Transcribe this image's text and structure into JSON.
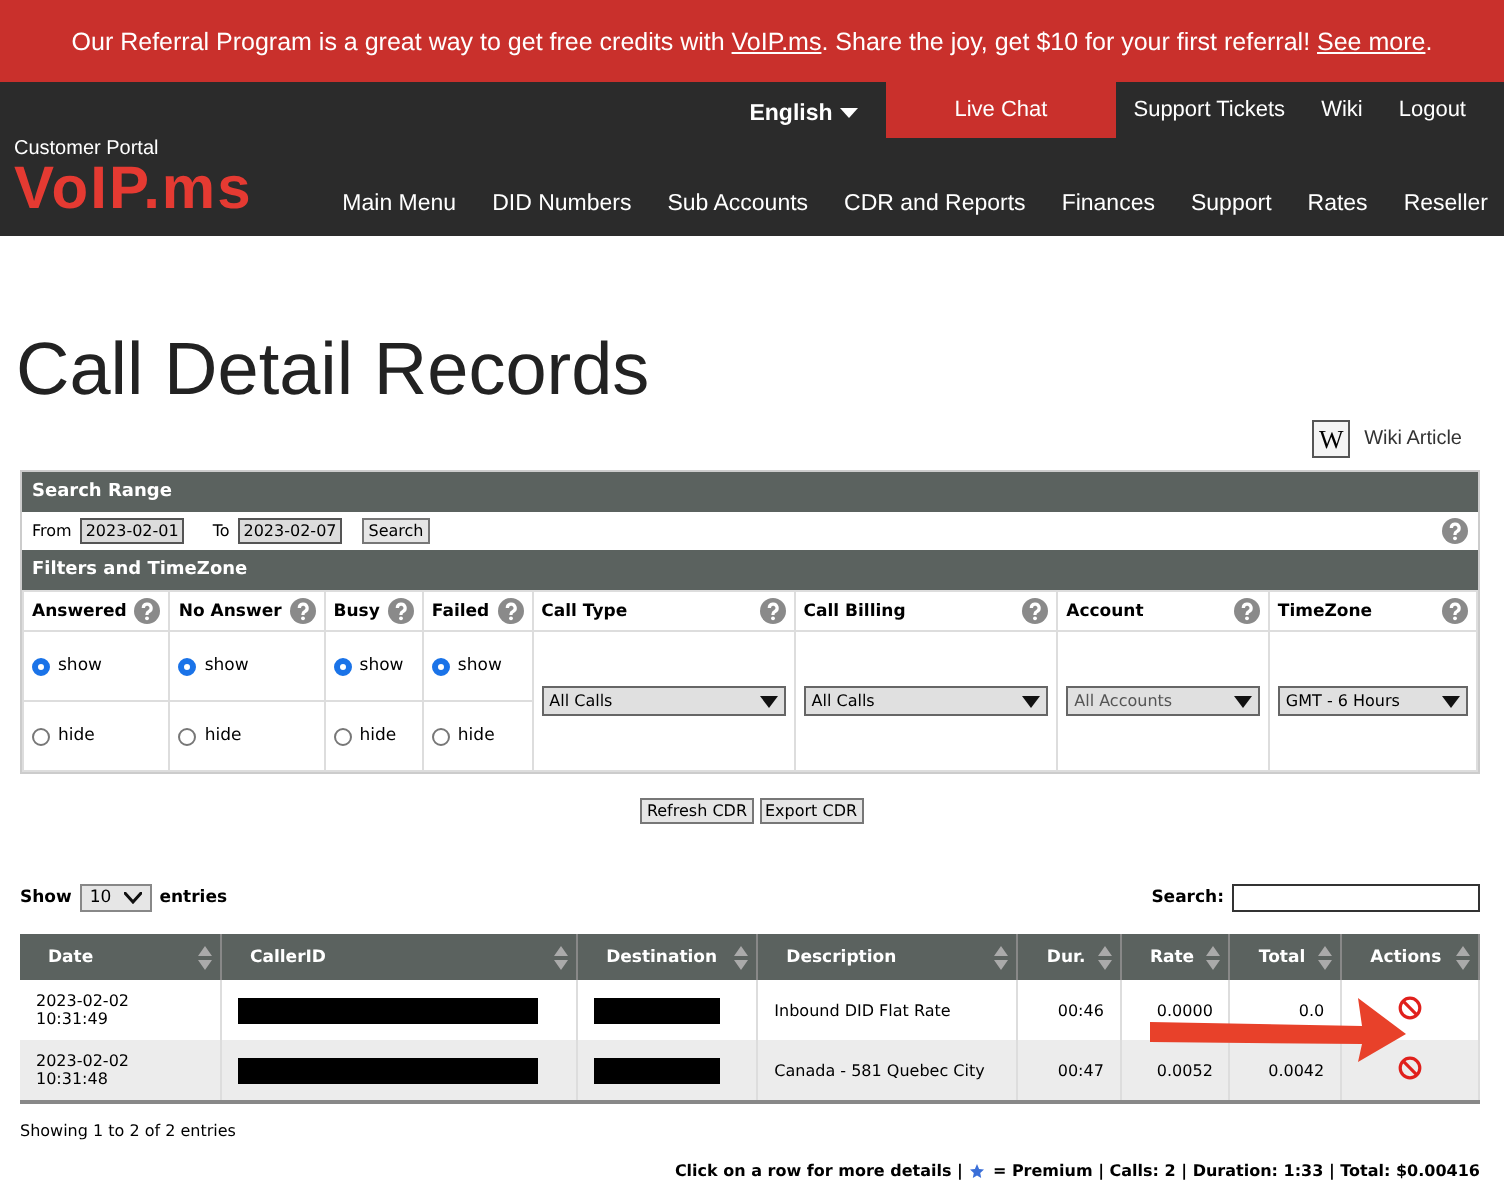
{
  "banner": [
    {
      "kind": "text",
      "text": "Our Referral Program is a great way to get free credits with "
    },
    {
      "kind": "link",
      "text": "VoIP.ms"
    },
    {
      "kind": "text",
      "text": ". Share the joy, get $10 for your first referral! "
    },
    {
      "kind": "link",
      "text": "See more"
    },
    {
      "kind": "text",
      "text": "."
    }
  ],
  "topbar": {
    "language": "English",
    "links": [
      {
        "label": "Live Chat",
        "selected": true
      },
      {
        "label": "Support Tickets",
        "selected": false
      },
      {
        "label": "Wiki",
        "selected": false
      },
      {
        "label": "Logout",
        "selected": false
      }
    ]
  },
  "brand": {
    "caption": "Customer Portal",
    "logo": "VoIP.ms"
  },
  "nav": [
    "Main Menu",
    "DID Numbers",
    "Sub Accounts",
    "CDR and Reports",
    "Finances",
    "Support",
    "Rates",
    "Reseller"
  ],
  "title": "Call Detail Records",
  "wiki_icon": "W",
  "wiki_link": "Wiki Article",
  "search_range": {
    "heading": "Search Range",
    "from_label": "From",
    "from": "2023-02-01",
    "to_label": "To",
    "to": "2023-02-07",
    "button": "Search"
  },
  "filters": {
    "heading": "Filters and TimeZone",
    "toggles": [
      {
        "label": "Answered",
        "options": [
          {
            "label": "show",
            "selected": true
          },
          {
            "label": "hide",
            "selected": false
          }
        ]
      },
      {
        "label": "No Answer",
        "options": [
          {
            "label": "show",
            "selected": true
          },
          {
            "label": "hide",
            "selected": false
          }
        ]
      },
      {
        "label": "Busy",
        "options": [
          {
            "label": "show",
            "selected": true
          },
          {
            "label": "hide",
            "selected": false
          }
        ]
      },
      {
        "label": "Failed",
        "options": [
          {
            "label": "show",
            "selected": true
          },
          {
            "label": "hide",
            "selected": false
          }
        ]
      }
    ],
    "selects": [
      {
        "label": "Call Type",
        "value": "All Calls"
      },
      {
        "label": "Call Billing",
        "value": "All Calls"
      },
      {
        "label": "Account",
        "value": "All Accounts"
      },
      {
        "label": "TimeZone",
        "value": "GMT - 6 Hours"
      }
    ]
  },
  "actions": [
    "Refresh CDR",
    "Export CDR"
  ],
  "length": {
    "before": "Show",
    "value": "10",
    "after": "entries"
  },
  "search": {
    "label": "Search:"
  },
  "table": {
    "columns": [
      "Date",
      "CallerID",
      "Destination",
      "Description",
      "Dur.",
      "Rate",
      "Total",
      "Actions"
    ],
    "rows": [
      {
        "date": "2023-02-02 10:31:49",
        "caller_id": {
          "kind": "redacted"
        },
        "destination": {
          "kind": "redacted"
        },
        "description": "Inbound DID Flat Rate",
        "duration": "00:46",
        "rate": "0.0000",
        "total": "0.0"
      },
      {
        "date": "2023-02-02 10:31:48",
        "caller_id": {
          "kind": "redacted"
        },
        "destination": {
          "kind": "redacted"
        },
        "description": "Canada - 581 Quebec City",
        "duration": "00:47",
        "rate": "0.0052",
        "total": "0.0042"
      }
    ]
  },
  "info": "Showing 1 to 2 of 2 entries",
  "summary": {
    "before": "Click on a row for more details |",
    "after": "= Premium | Calls: 2 | Duration: 1:33 | Total: $0.00416"
  },
  "annotation": {
    "kind": "arrow"
  }
}
